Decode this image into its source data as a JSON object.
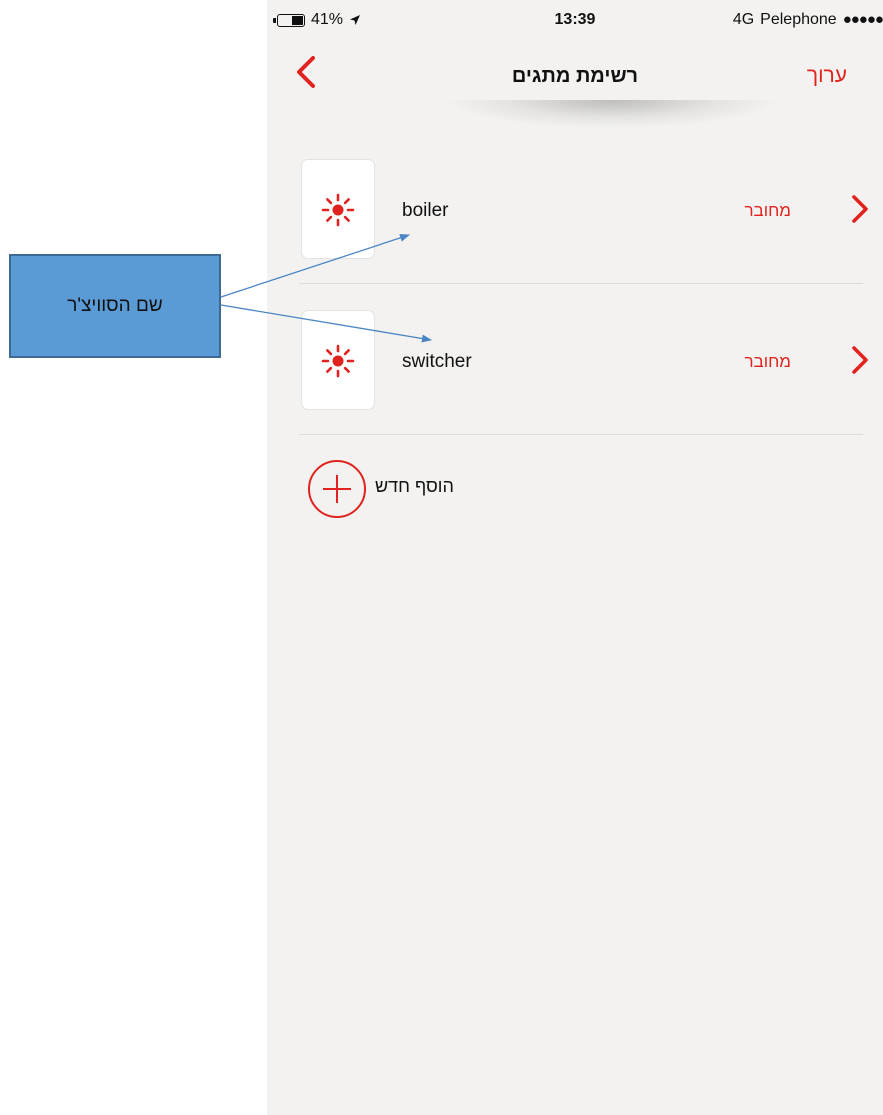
{
  "status_bar": {
    "battery": "41%",
    "battery_level": 0.41,
    "time": "13:39",
    "network": "4G",
    "carrier": "Pelephone",
    "signal_dots": "●●●●●"
  },
  "nav": {
    "title": "רשימת מתגים",
    "edit_label": "ערוך",
    "back_icon": "chevron-left-icon"
  },
  "devices": [
    {
      "name": "boiler",
      "status": "מחובר",
      "icon": "sun-icon"
    },
    {
      "name": "switcher",
      "status": "מחובר",
      "icon": "sun-icon"
    }
  ],
  "add_new": {
    "label": "הוסף חדש",
    "icon": "plus-circle-icon"
  },
  "annotation": {
    "text": "שם הסוויצ'ר"
  },
  "colors": {
    "accent": "#e0231f",
    "background": "#f3f2f0",
    "callout_fill": "#5b9bd5",
    "callout_border": "#3c6a94",
    "arrow": "#4a86c5"
  }
}
